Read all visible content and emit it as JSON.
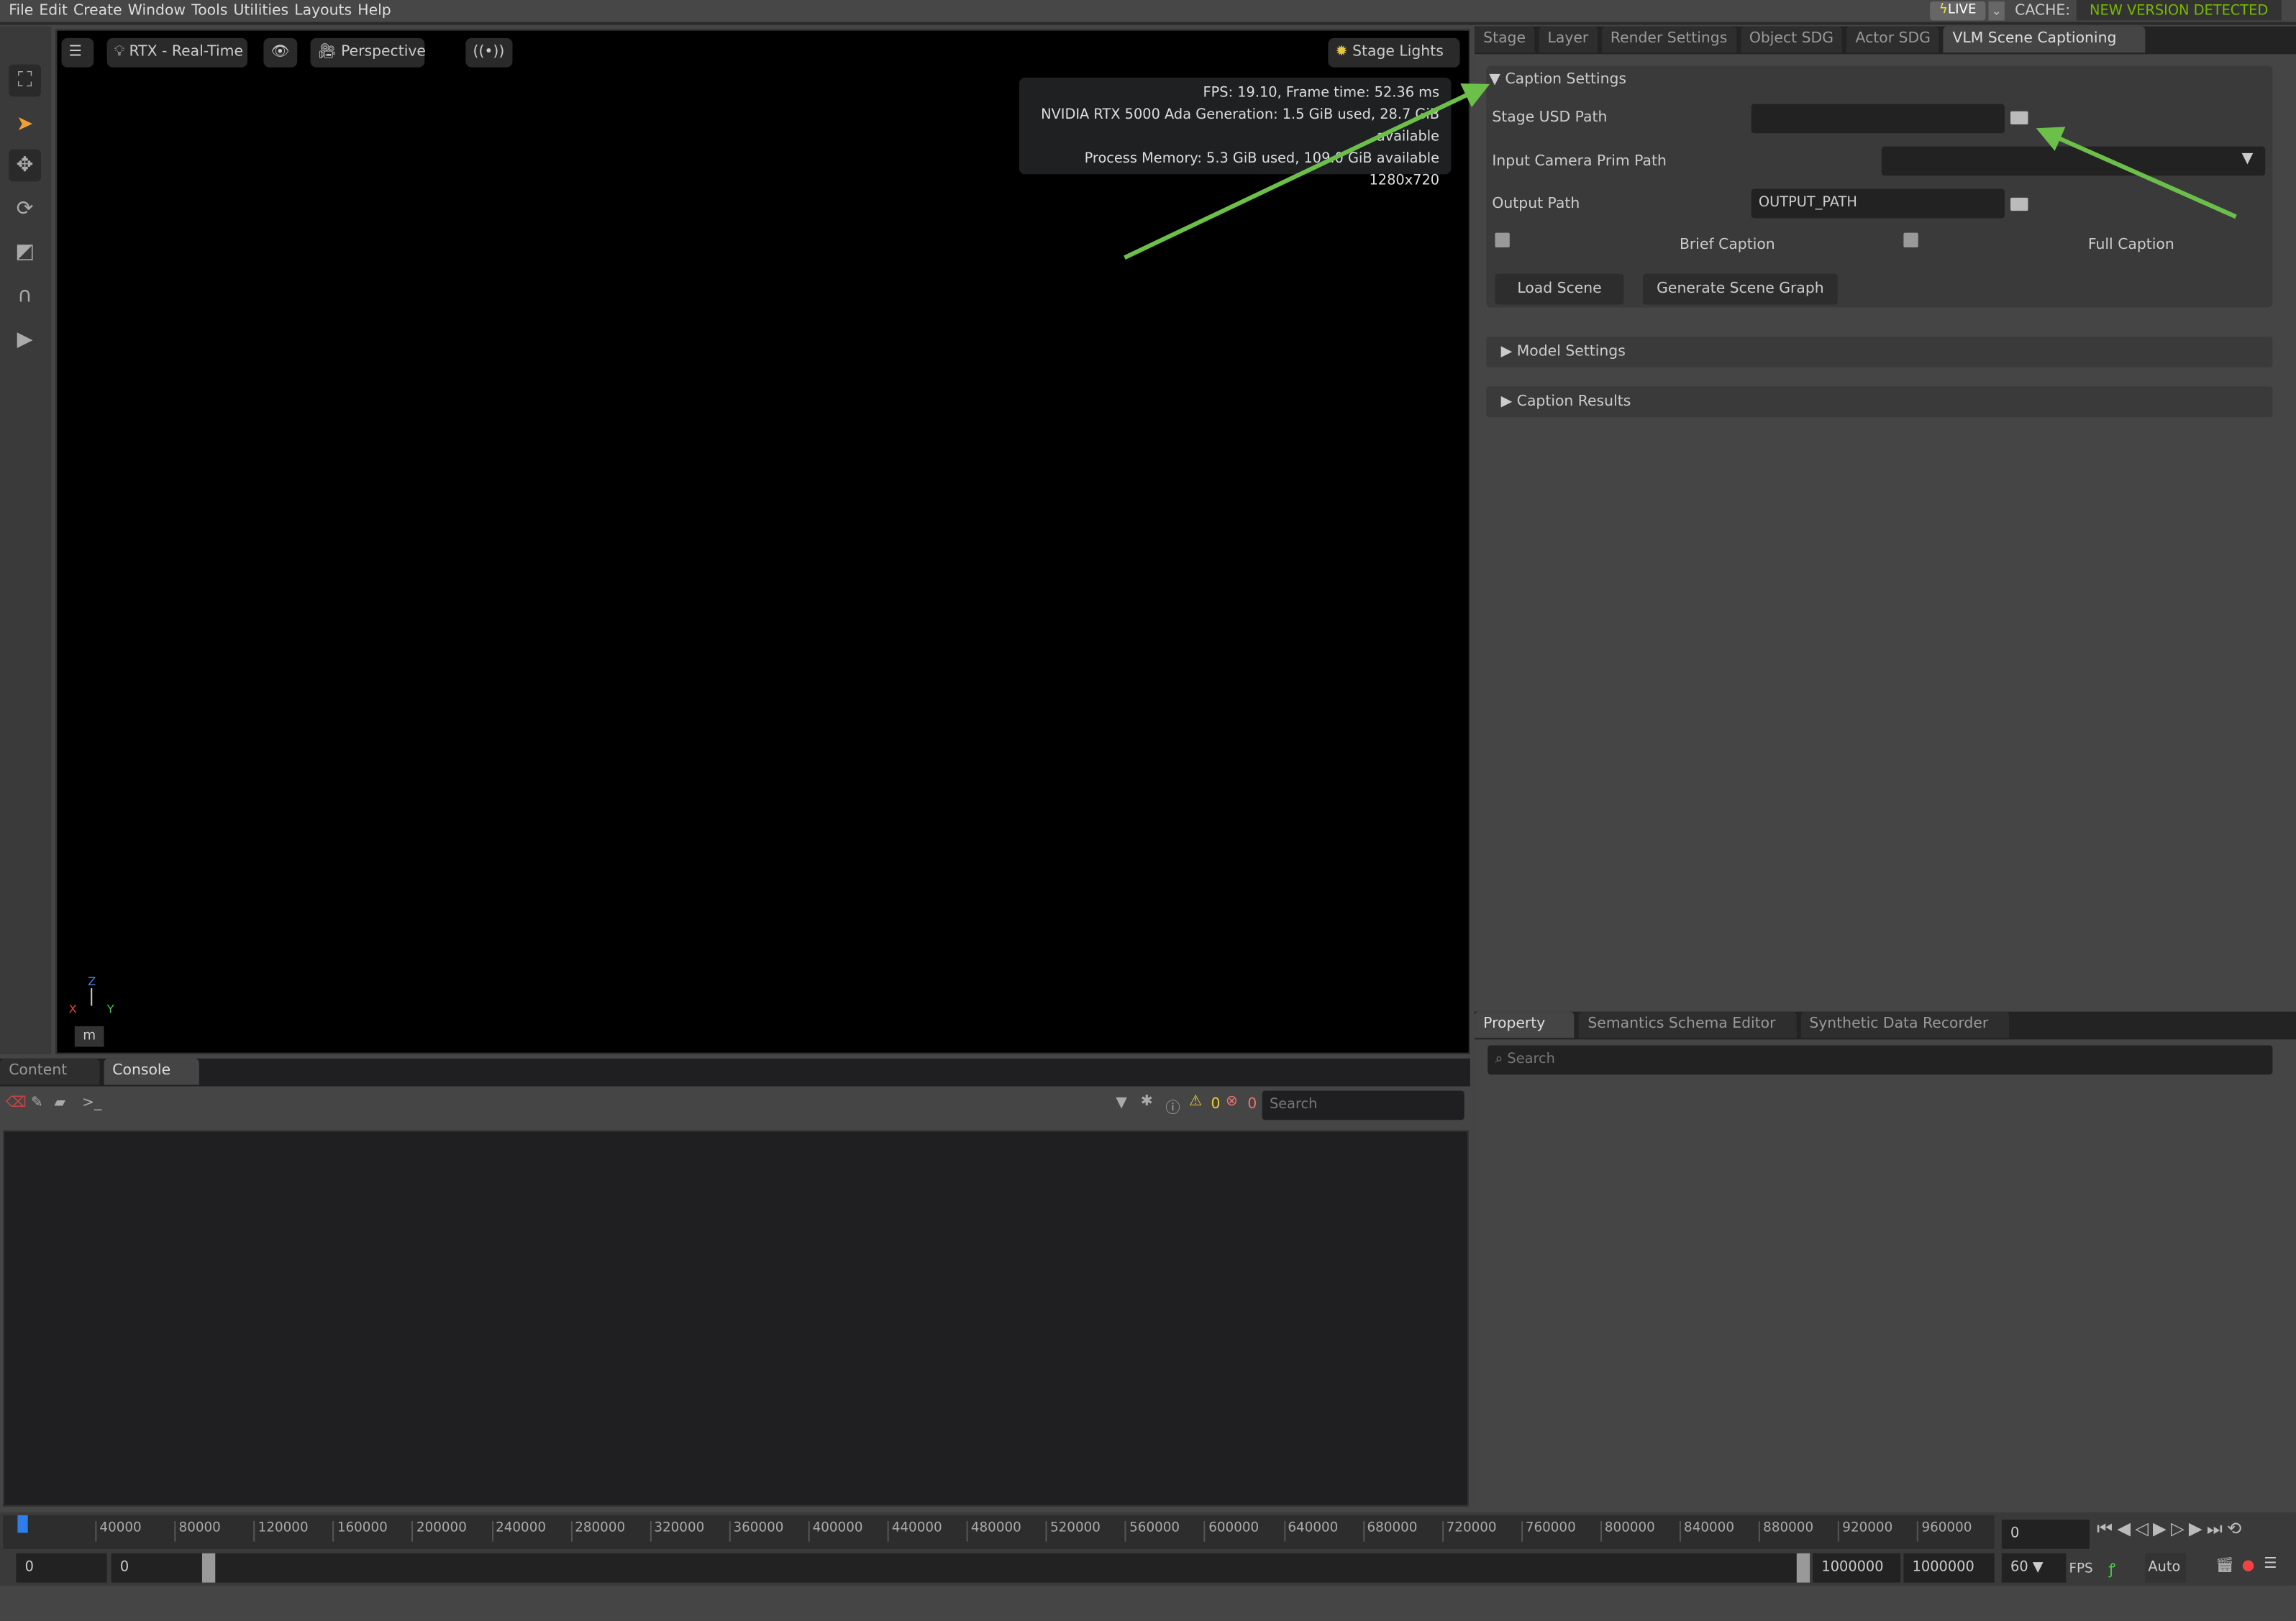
{
  "menu": [
    "File",
    "Edit",
    "Create",
    "Window",
    "Tools",
    "Utilities",
    "Layouts",
    "Help"
  ],
  "status": {
    "live": "LIVE",
    "cache_label": "CACHE:",
    "cache_value": "NEW VERSION DETECTED",
    "cache_color": "#76b900"
  },
  "viewport": {
    "renderer": "RTX - Real-Time",
    "camera": "Perspective",
    "lights": "Stage Lights",
    "unit": "m",
    "stats": [
      "FPS: 19.10, Frame time: 52.36 ms",
      "NVIDIA RTX 5000 Ada Generation: 1.5 GiB used, 28.7 GiB available",
      "Process Memory: 5.3 GiB used, 109.0 GiB available",
      "1280x720"
    ],
    "axes": {
      "x": "X",
      "y": "Y",
      "z": "Z"
    }
  },
  "right_tabs": [
    "Stage",
    "Layer",
    "Render Settings",
    "Object SDG",
    "Actor SDG",
    "VLM Scene Captioning"
  ],
  "caption_settings": {
    "title": "Caption Settings",
    "stage_usd_path_label": "Stage USD Path",
    "stage_usd_path_value": "",
    "camera_label": "Input Camera Prim Path",
    "camera_value": "",
    "output_path_label": "Output Path",
    "output_path_value": "OUTPUT_PATH",
    "brief_caption": "Brief Caption",
    "full_caption": "Full Caption",
    "load_scene": "Load Scene",
    "generate_scene_graph": "Generate Scene Graph"
  },
  "model_settings": "Model Settings",
  "caption_results": "Caption Results",
  "property_tabs": [
    "Property",
    "Semantics Schema Editor",
    "Synthetic Data Recorder"
  ],
  "property_search_placeholder": "Search",
  "bottom_tabs": [
    "Content",
    "Console"
  ],
  "console": {
    "warnings": "0",
    "errors": "0",
    "search_placeholder": "Search"
  },
  "timeline": {
    "ticks": [
      "40000",
      "80000",
      "120000",
      "160000",
      "200000",
      "240000",
      "280000",
      "320000",
      "360000",
      "400000",
      "440000",
      "480000",
      "520000",
      "560000",
      "600000",
      "640000",
      "680000",
      "720000",
      "760000",
      "800000",
      "840000",
      "880000",
      "920000",
      "960000"
    ],
    "current": "0",
    "start": "0",
    "start2": "0",
    "end": "1000000",
    "end2": "1000000",
    "fps": "60",
    "fps_label": "FPS",
    "auto": "Auto"
  },
  "annotation_color": "#6cc04a"
}
